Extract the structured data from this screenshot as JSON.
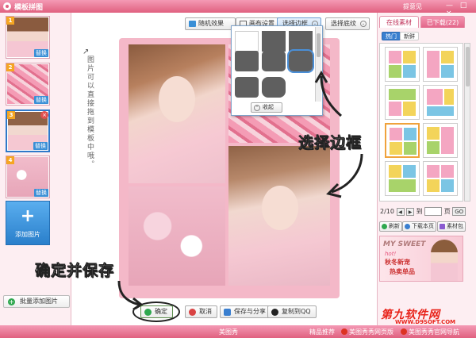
{
  "window": {
    "title": "模板拼图",
    "feedback": "提意见",
    "controls": "— □ ×"
  },
  "left_panel": {
    "thumbs": [
      {
        "num": "1",
        "replace": "替换"
      },
      {
        "num": "2",
        "replace": "替换"
      },
      {
        "num": "3",
        "replace": "替换",
        "close": "×"
      },
      {
        "num": "4",
        "replace": "替换"
      }
    ],
    "add_image": {
      "plus": "+",
      "label": "添加图片"
    },
    "batch_add": {
      "icon": "+",
      "label": "批量添加图片"
    }
  },
  "toolbar": {
    "random": "随机效果",
    "canvas": "画布设置",
    "border": "选择边框",
    "filter": "选择底纹",
    "dropdown_icon": "⌄"
  },
  "border_menu": {
    "collapse_icon": "⌃",
    "collapse": "收起"
  },
  "hint": "图片可以直接拖到模板中哦。",
  "hint_arrow": "↗",
  "annotations": {
    "choose_border": "选择边框",
    "confirm_save": "确定并保存"
  },
  "bottom": {
    "ok": "确定",
    "cancel": "取消",
    "save_share": "保存与分享",
    "copy_qq": "复制到QQ"
  },
  "right_panel": {
    "tab_online": "在线素材",
    "tab_downloaded": "已下载(22)",
    "sub_hot": "热门",
    "sub_new": "新鲜",
    "pager": {
      "current": "2/10",
      "prev": "◀",
      "next": "▶",
      "to": "到",
      "page": "页",
      "go": "GO"
    },
    "refresh": "刷新",
    "download_page": "下载本页",
    "material_pack": "素材包",
    "ad": {
      "l1": "MY SWEET",
      "l2": "hot!",
      "l3": "秋冬新宠",
      "l4": "热卖单品"
    }
  },
  "status": {
    "center": "美图秀",
    "rec": "精品推荐",
    "link1": "美图秀秀网页版",
    "link2": "美图秀秀官网导航"
  },
  "watermark": {
    "site": "第九软件网",
    "url": "WWW.D9SOFT.COM"
  },
  "colors": {
    "accent": "#e0607f",
    "selection": "#2f79c9",
    "ok_green": "#2fa84f"
  }
}
